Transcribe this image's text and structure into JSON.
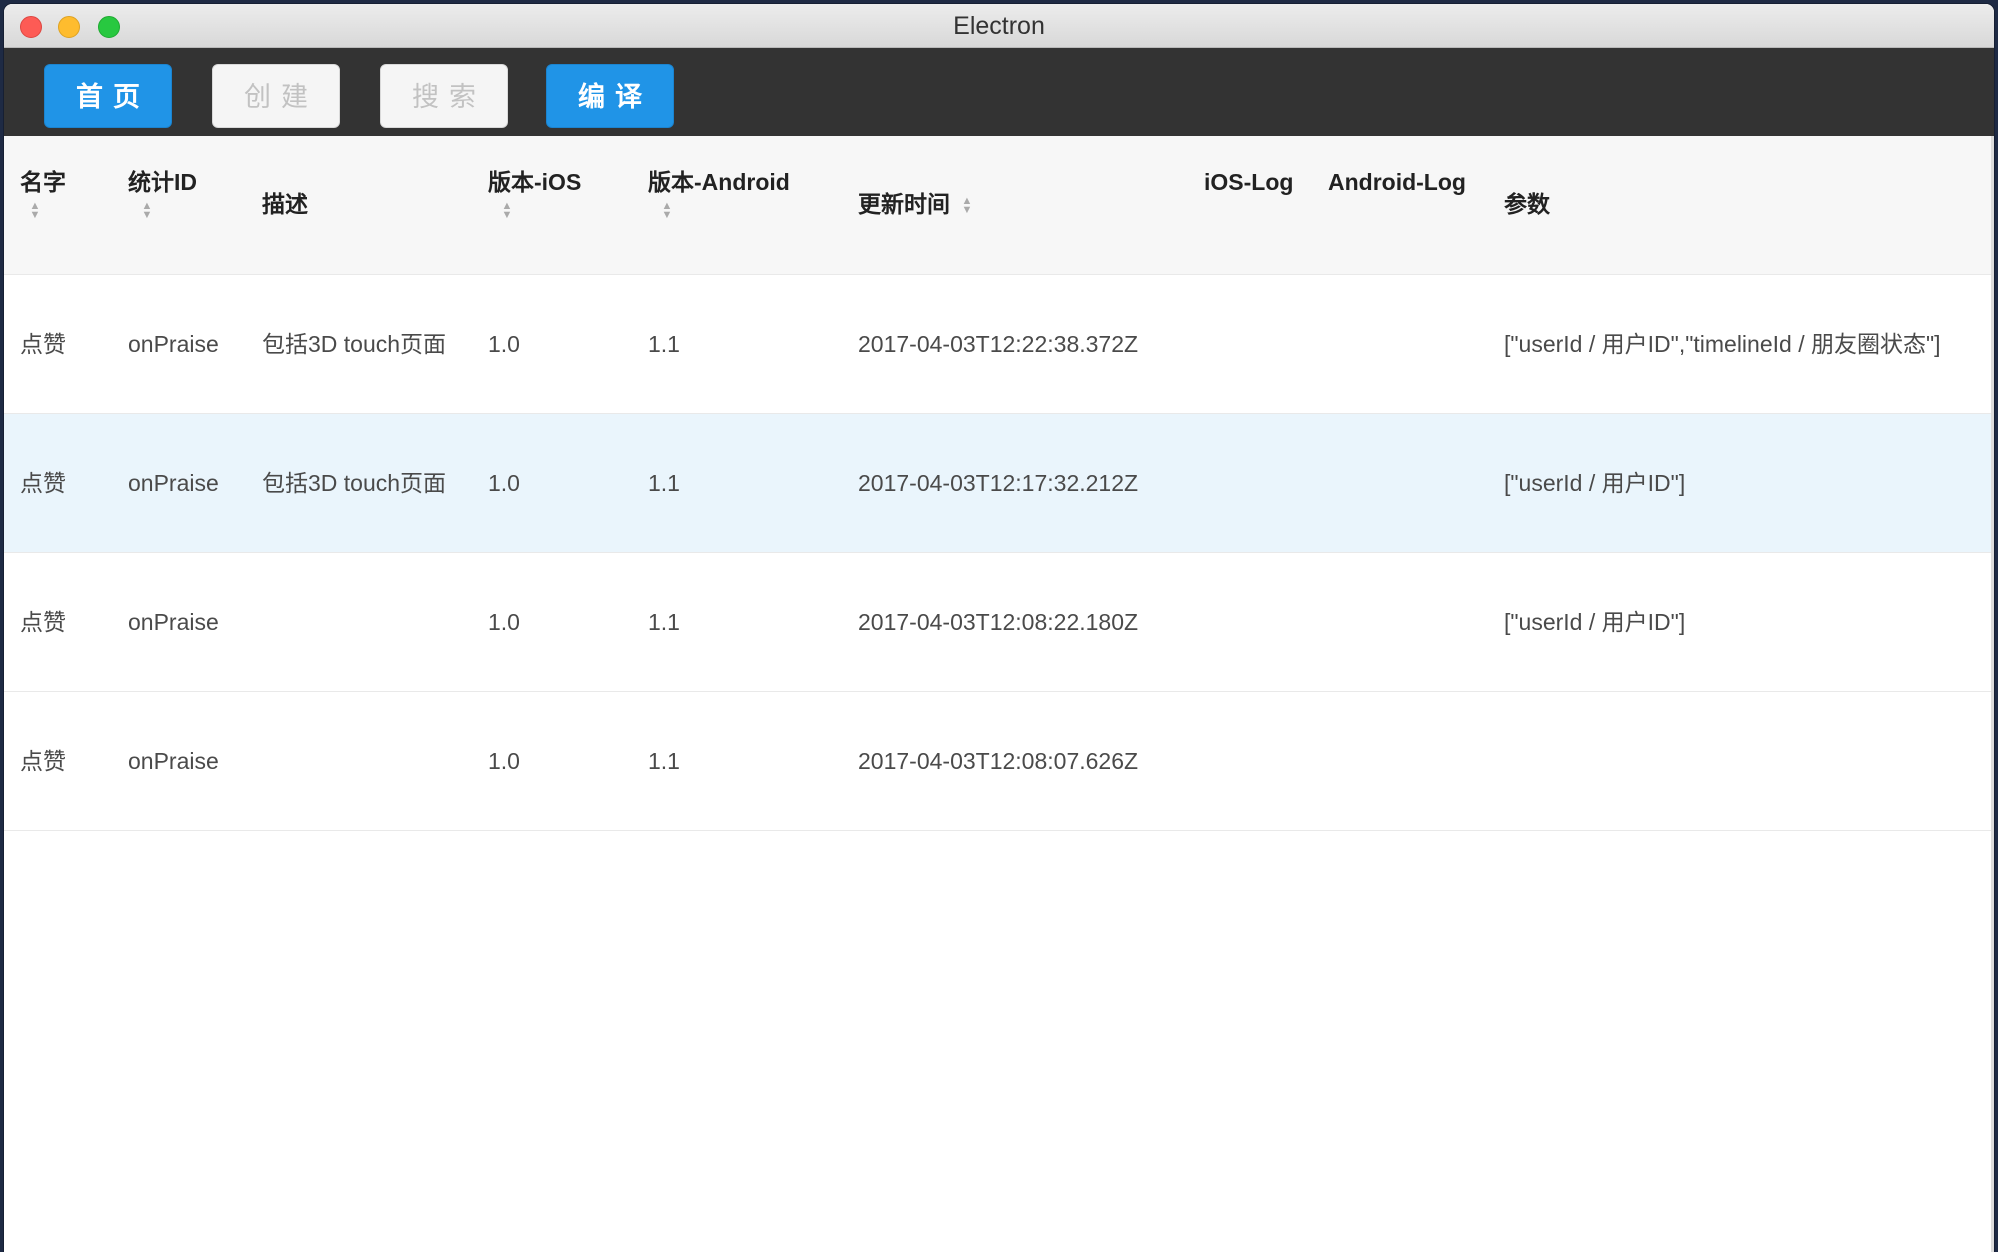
{
  "window": {
    "title": "Electron"
  },
  "toolbar": {
    "buttons": [
      {
        "label": "首页",
        "state": "active"
      },
      {
        "label": "创建",
        "state": "disabled"
      },
      {
        "label": "搜索",
        "state": "disabled"
      },
      {
        "label": "编译",
        "state": "active"
      }
    ]
  },
  "table": {
    "columns": [
      {
        "label": "名字",
        "sortable": true
      },
      {
        "label": "统计ID",
        "sortable": true
      },
      {
        "label": "描述",
        "sortable": false
      },
      {
        "label": "版本-iOS",
        "sortable": true
      },
      {
        "label": "版本-Android",
        "sortable": true
      },
      {
        "label": "更新时间",
        "sortable": true
      },
      {
        "label": "iOS-Log",
        "sortable": false
      },
      {
        "label": "Android-Log",
        "sortable": false
      },
      {
        "label": "参数",
        "sortable": false
      }
    ],
    "rows": [
      {
        "name": "点赞",
        "stat_id": "onPraise",
        "desc": "包括3D touch页面",
        "ver_ios": "1.0",
        "ver_android": "1.1",
        "updated": "2017-04-03T12:22:38.372Z",
        "ios_log": "",
        "android_log": "",
        "params": "[\"userId / 用户ID\",\"timelineId / 朋友圈状态\"]"
      },
      {
        "name": "点赞",
        "stat_id": "onPraise",
        "desc": "包括3D touch页面",
        "ver_ios": "1.0",
        "ver_android": "1.1",
        "updated": "2017-04-03T12:17:32.212Z",
        "ios_log": "",
        "android_log": "",
        "params": "[\"userId / 用户ID\"]"
      },
      {
        "name": "点赞",
        "stat_id": "onPraise",
        "desc": "",
        "ver_ios": "1.0",
        "ver_android": "1.1",
        "updated": "2017-04-03T12:08:22.180Z",
        "ios_log": "",
        "android_log": "",
        "params": "[\"userId / 用户ID\"]"
      },
      {
        "name": "点赞",
        "stat_id": "onPraise",
        "desc": "",
        "ver_ios": "1.0",
        "ver_android": "1.1",
        "updated": "2017-04-03T12:08:07.626Z",
        "ios_log": "",
        "android_log": "",
        "params": ""
      }
    ]
  }
}
